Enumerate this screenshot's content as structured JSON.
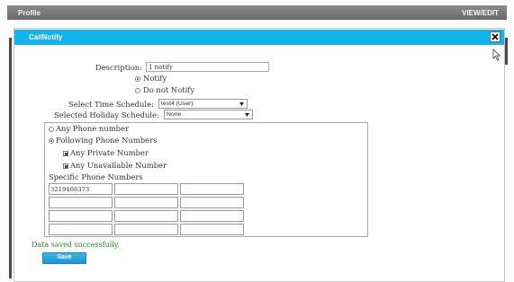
{
  "top_bar": {
    "left_label": "Profile",
    "right_label": "VIEW/EDIT"
  },
  "dialog": {
    "title": "CallNotify",
    "description_label": "Description:",
    "description_value": "1 notify",
    "notify_label": "Notify",
    "do_not_notify_label": "Do not Notify",
    "time_schedule_label": "Select Time Schedule:",
    "time_schedule_value": "test4 (User)",
    "holiday_schedule_label": "Selected Holiday Schedule:",
    "holiday_schedule_value": "None",
    "any_phone_label": "Any Phone number",
    "following_numbers_label": "Following Phone Numbers",
    "any_private_label": "Any Private Number",
    "any_unavailable_label": "Any Unavailable Number",
    "specific_numbers_label": "Specific Phone Numbers",
    "phone_numbers": [
      [
        "3219466373",
        "",
        ""
      ],
      [
        "",
        "",
        ""
      ],
      [
        "",
        "",
        ""
      ],
      [
        "",
        "",
        ""
      ]
    ],
    "status_message": "Data saved successfully.",
    "save_label": "Save"
  }
}
